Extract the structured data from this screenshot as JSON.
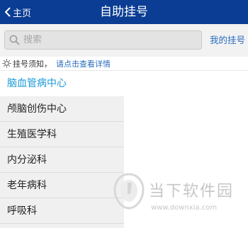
{
  "header": {
    "back_label": "主页",
    "title": "自助挂号"
  },
  "search": {
    "placeholder": "搜索",
    "my_registration": "我的挂号"
  },
  "notice": {
    "label": "挂号须知，",
    "link": "请点击查看详情"
  },
  "departments": [
    {
      "label": "脑血管病中心"
    },
    {
      "label": "颅脑创伤中心"
    },
    {
      "label": "生殖医学科"
    },
    {
      "label": "内分泌科"
    },
    {
      "label": "老年病科"
    },
    {
      "label": "呼吸科"
    }
  ],
  "watermark": {
    "site_name": "当下软件园",
    "url": "www.downxia.com"
  },
  "colors": {
    "header_bg": "#0a3d93",
    "link": "#2a6dbd",
    "selected_item": "#1a9ad6",
    "list_bg": "#f0f0f0"
  },
  "icons": {
    "back": "chevron-left-icon",
    "search": "search-icon",
    "notice": "sun-icon"
  }
}
